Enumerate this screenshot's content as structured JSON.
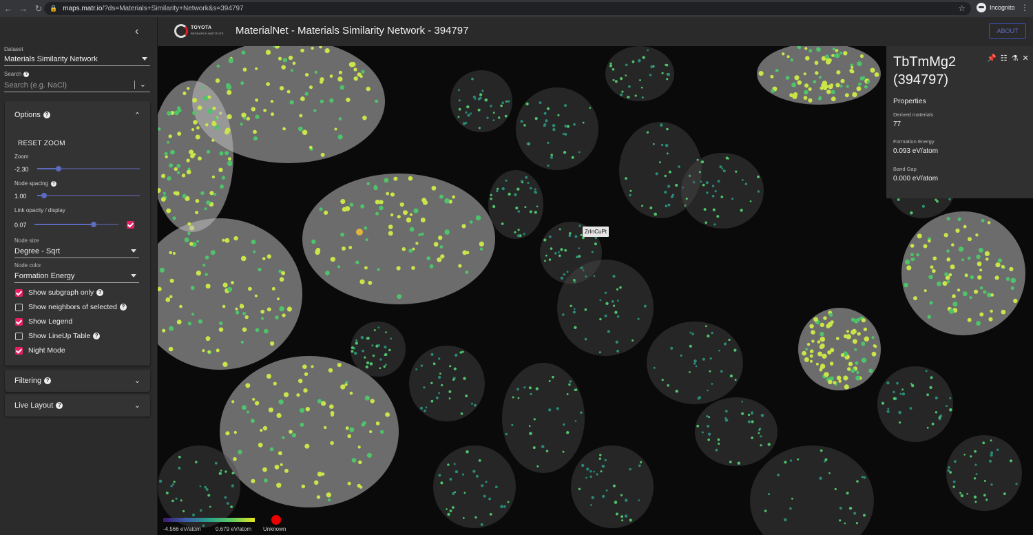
{
  "browser": {
    "url_host": "maps.matr.io",
    "url_path": "/?ds=Materials+Similarity+Network&s=394797",
    "profile_label": "Incognito"
  },
  "header": {
    "logo_line1": "TOYOTA",
    "logo_line2": "RESEARCH INSTITUTE",
    "title": "MaterialNet - Materials Similarity Network - 394797",
    "about_label": "ABOUT"
  },
  "sidebar": {
    "dataset_label": "Dataset",
    "dataset_value": "Materials Similarity Network",
    "search_label": "Search",
    "search_placeholder": "Search (e.g. NaCl)",
    "options": {
      "title": "Options",
      "reset_zoom": "RESET ZOOM",
      "zoom_label": "Zoom",
      "zoom_value": "-2.30",
      "node_spacing_label": "Node spacing",
      "node_spacing_value": "1.00",
      "link_opacity_label": "Link opacity / display",
      "link_opacity_value": "0.07",
      "node_size_label": "Node size",
      "node_size_value": "Degree - Sqrt",
      "node_color_label": "Node color",
      "node_color_value": "Formation Energy",
      "checks": [
        {
          "label": "Show subgraph only",
          "checked": true
        },
        {
          "label": "Show neighbors of selected",
          "checked": false
        },
        {
          "label": "Show Legend",
          "checked": true
        },
        {
          "label": "Show LineUp Table",
          "checked": false
        },
        {
          "label": "Night Mode",
          "checked": true
        }
      ]
    },
    "filtering_title": "Filtering",
    "live_layout_title": "Live Layout"
  },
  "graph": {
    "tooltip": "ZrInCuPt",
    "legend": {
      "min_label": "-4.566 eV/atom",
      "max_label": "0.679 eV/atom",
      "unknown_label": "Unknown"
    }
  },
  "detail": {
    "title": "TbTmMg2 (394797)",
    "subtitle": "Properties",
    "props": [
      {
        "label": "Derived materials",
        "value": "77"
      },
      {
        "label": "Formation Energy",
        "value": "0.093 eV/atom"
      },
      {
        "label": "Band Gap",
        "value": "0.000 eV/atom"
      }
    ]
  },
  "colors": {
    "accent_pink": "#e91e63",
    "slider_blue": "#5c6bc0",
    "node_green_light": "#c9e54a",
    "node_green": "#4fc36a",
    "node_teal": "#2a8a76"
  }
}
